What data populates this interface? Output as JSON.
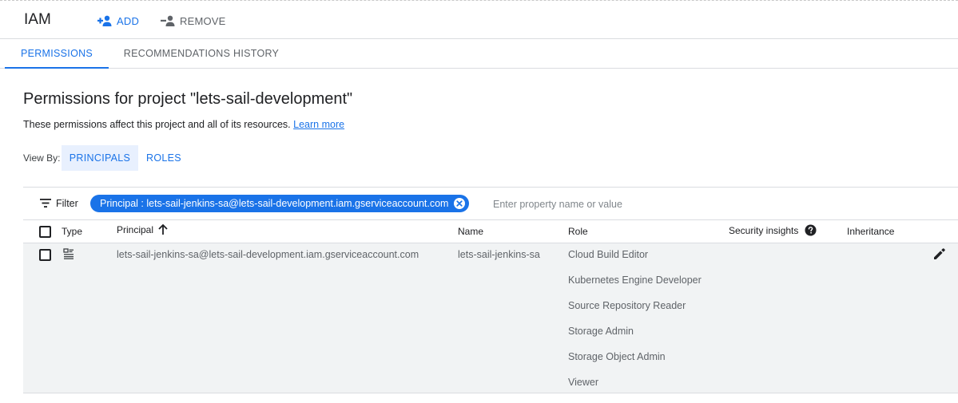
{
  "app": {
    "title": "IAM",
    "add_label": "ADD",
    "remove_label": "REMOVE"
  },
  "tabs": [
    {
      "label": "PERMISSIONS",
      "active": true
    },
    {
      "label": "RECOMMENDATIONS HISTORY",
      "active": false
    }
  ],
  "page": {
    "title": "Permissions for project \"lets-sail-development\"",
    "subtitle": "These permissions affect this project and all of its resources.",
    "learn_more": "Learn more"
  },
  "view_by": {
    "label": "View By:",
    "options": [
      "PRINCIPALS",
      "ROLES"
    ],
    "selected": "PRINCIPALS"
  },
  "filter": {
    "label": "Filter",
    "chip": "Principal : lets-sail-jenkins-sa@lets-sail-development.iam.gserviceaccount.com",
    "placeholder": "Enter property name or value"
  },
  "table": {
    "columns": [
      "Type",
      "Principal",
      "Name",
      "Role",
      "Security insights",
      "Inheritance"
    ],
    "sort_column": "Principal",
    "sort_direction": "ascending",
    "rows": [
      {
        "type_icon": "service-account-icon",
        "principal": "lets-sail-jenkins-sa@lets-sail-development.iam.gserviceaccount.com",
        "name": "lets-sail-jenkins-sa",
        "roles": [
          "Cloud Build Editor",
          "Kubernetes Engine Developer",
          "Source Repository Reader",
          "Storage Admin",
          "Storage Object Admin",
          "Viewer"
        ]
      }
    ]
  },
  "colors": {
    "accent": "#1a73e8",
    "row_background": "#f1f3f4",
    "selected_view_background": "#e8f0fe"
  }
}
